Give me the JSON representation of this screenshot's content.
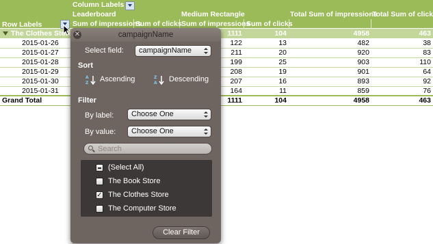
{
  "pivot": {
    "column_labels": "Column Labels",
    "row_labels": "Row Labels",
    "groups": [
      "Leaderboard",
      "Medium Rectangle"
    ],
    "subheaders": [
      "Sum of impressions",
      "Sum of clicks",
      "Sum of impressions",
      "Sum of clicks"
    ],
    "total_impressions_header": "Total Sum of impressions",
    "total_clicks_header": "Total Sum of clicks",
    "store_row": {
      "label": "The Clothes Store",
      "mr_impressions": "1111",
      "mr_clicks": "104",
      "total_impressions": "4958",
      "total_clicks": "463"
    },
    "rows": [
      {
        "date": "2015-01-26",
        "mr_impressions": "122",
        "mr_clicks": "13",
        "total_impressions": "482",
        "total_clicks": "38"
      },
      {
        "date": "2015-01-27",
        "mr_impressions": "211",
        "mr_clicks": "20",
        "total_impressions": "920",
        "total_clicks": "83"
      },
      {
        "date": "2015-01-28",
        "mr_impressions": "199",
        "mr_clicks": "25",
        "total_impressions": "903",
        "total_clicks": "110"
      },
      {
        "date": "2015-01-29",
        "mr_impressions": "208",
        "mr_clicks": "19",
        "total_impressions": "901",
        "total_clicks": "64"
      },
      {
        "date": "2015-01-30",
        "mr_impressions": "207",
        "mr_clicks": "16",
        "total_impressions": "893",
        "total_clicks": "92"
      },
      {
        "date": "2015-01-31",
        "mr_impressions": "164",
        "mr_clicks": "11",
        "total_impressions": "859",
        "total_clicks": "76"
      }
    ],
    "grand_total": {
      "label": "Grand Total",
      "mr_impressions": "1111",
      "mr_clicks": "104",
      "total_impressions": "4958",
      "total_clicks": "463"
    }
  },
  "popup": {
    "title": "campaignName",
    "select_field_label": "Select field:",
    "select_field_value": "campaignName",
    "sort_heading": "Sort",
    "ascending": "Ascending",
    "descending": "Descending",
    "filter_heading": "Filter",
    "by_label": "By label:",
    "by_label_value": "Choose One",
    "by_value": "By value:",
    "by_value_value": "Choose One",
    "search_placeholder": "Search",
    "items": [
      {
        "label": "(Select All)",
        "state": "mixed"
      },
      {
        "label": "The Book Store",
        "state": "unchecked"
      },
      {
        "label": "The Clothes Store",
        "state": "checked"
      },
      {
        "label": "The Computer Store",
        "state": "unchecked"
      }
    ],
    "clear_filter": "Clear Filter"
  },
  "colors": {
    "header_green": "#9bbb59",
    "row_highlight": "#c4d79b",
    "popup_bg": "#6f6560"
  }
}
